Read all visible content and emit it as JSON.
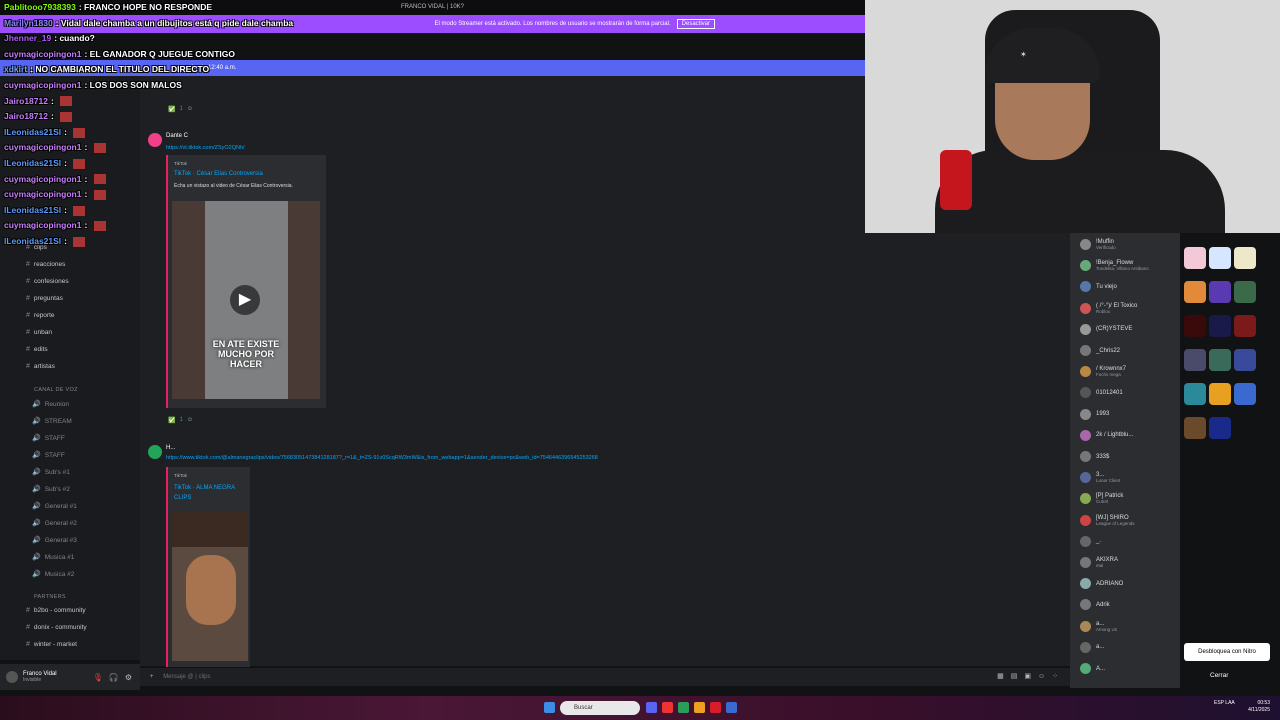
{
  "window_title": "FRANCO VIDAL | 10K?",
  "banner": {
    "message": "El modo Streamer está activado. Los nombres de usuario se mostrarán de forma parcial.",
    "button": "Desactivar"
  },
  "stage_bar": "desde 12:40 a.m.",
  "chat": [
    {
      "user": "Pablitooo7938393",
      "color": "#7fff00",
      "text": "FRANCO HOPE NO RESPONDE"
    },
    {
      "user": "Marilyn1830",
      "color": "#8a8aff",
      "text": "Vidal dale chamba a un dibujitos está q pide dale chamba"
    },
    {
      "user": "Jhenner_19",
      "color": "#b05cff",
      "text": "cuando?"
    },
    {
      "user": "cuymagicopingon1",
      "color": "#c87cff",
      "text": "EL GANADOR Q JUEGUE CONTIGO"
    },
    {
      "user": "xdkirt",
      "color": "#6fa8ff",
      "text": "NO CAMBIARON EL TITULO DEL DIRECTO"
    },
    {
      "user": "cuymagicopingon1",
      "color": "#c87cff",
      "text": "LOS DOS SON MALOS"
    },
    {
      "user": "Jairo18712",
      "color": "#c87cff",
      "text": ""
    },
    {
      "user": "Jairo18712",
      "color": "#c87cff",
      "text": ""
    },
    {
      "user": "lLeonidas21Sl",
      "color": "#5b9bff",
      "text": ""
    },
    {
      "user": "cuymagicopingon1",
      "color": "#c87cff",
      "text": ""
    },
    {
      "user": "lLeonidas21Sl",
      "color": "#5b9bff",
      "text": ""
    },
    {
      "user": "cuymagicopingon1",
      "color": "#c87cff",
      "text": ""
    },
    {
      "user": "cuymagicopingon1",
      "color": "#c87cff",
      "text": ""
    },
    {
      "user": "lLeonidas21Sl",
      "color": "#5b9bff",
      "text": ""
    },
    {
      "user": "cuymagicopingon1",
      "color": "#c87cff",
      "text": ""
    },
    {
      "user": "lLeonidas21Sl",
      "color": "#5b9bff",
      "text": ""
    }
  ],
  "sidebar": {
    "channels": [
      "clips",
      "reacciones",
      "confesiones",
      "preguntas",
      "reporte",
      "unban",
      "edits",
      "artistas"
    ],
    "voice_category": "CANAL DE VOZ",
    "voice": [
      "Reunion",
      "STREAM",
      "STAFF",
      "STAFF",
      "Sub's #1",
      "Sub's #2",
      "General #1",
      "General #2",
      "General #3",
      "Musica #1",
      "Musica #2"
    ],
    "partners_category": "PARTNERS",
    "partners": [
      "b2bo - community",
      "donix - community",
      "winter - market"
    ]
  },
  "user_panel": {
    "name": "Franco Vidal",
    "status": "Invisible"
  },
  "messages": [
    {
      "author": "Dante C",
      "link": "https://vt.tiktok.com/ZSyO2QNh/",
      "provider": "TikTok",
      "title": "TikTok · César Elias Controversia",
      "desc": "Echa un vistazo al video de César Elias Controversia.",
      "overlay": "EN ATE EXISTE MUCHO POR HACER",
      "reaction": "1"
    },
    {
      "author": "H...",
      "link": "https://www.tiktok.com/@almanegraclips/video/7568305147384128187?_r=1&_t=ZS-91v0ScqRW3mW&is_from_webapp=1&sender_device=pc&web_id=7546446396545253268",
      "provider": "TikTok",
      "title": "TikTok · ALMA NEGRA CLIPS",
      "reaction": "1"
    }
  ],
  "composer_placeholder": "Mensaje @ | clips",
  "members": [
    {
      "name": "!Muffin",
      "sub": "Verificado"
    },
    {
      "name": "!Benja_Floww",
      "sub": "Tondelita, Villano Antibano"
    },
    {
      "name": "Tu viejo",
      "sub": ""
    },
    {
      "name": "( /°-°)/ El Toxico",
      "sub": "Roblox"
    },
    {
      "name": "(CR)YSTEVE",
      "sub": ""
    },
    {
      "name": "_Chris22",
      "sub": ""
    },
    {
      "name": "/ Krownnx7",
      "sub": "Fuchs mega"
    },
    {
      "name": "01012401",
      "sub": ""
    },
    {
      "name": "1993",
      "sub": ""
    },
    {
      "name": "2k / Lightblu...",
      "sub": ""
    },
    {
      "name": "333$",
      "sub": ""
    },
    {
      "name": "3...",
      "sub": "Lunar Client"
    },
    {
      "name": "[P] Patrick",
      "sub": "Cutrel"
    },
    {
      "name": "[WJ] SHIRO",
      "sub": "League of Legends"
    },
    {
      "name": "_.",
      "sub": ""
    },
    {
      "name": "AKIXRA",
      "sub": "etal"
    },
    {
      "name": "ADRIANO",
      "sub": ""
    },
    {
      "name": "Adrik",
      "sub": ""
    },
    {
      "name": "a...",
      "sub": "Among Us"
    },
    {
      "name": "a...",
      "sub": ""
    },
    {
      "name": "A...",
      "sub": ""
    }
  ],
  "theme_colors": [
    "#f3c9d8",
    "#d6e6ff",
    "#efe7c9",
    "#e08a3a",
    "#5a3ab0",
    "#3a6a4a",
    "#3a0a0a",
    "#1a1a4a",
    "#7a1a1a",
    "#4a4a6a",
    "#3a6a5a",
    "#3a4a9a",
    "#2a8a9a",
    "#e8a020",
    "#3a6ad0",
    "#6a4a2a",
    "#1a2a8a"
  ],
  "nitro_button": "Desbloquea con Nitro",
  "close_button": "Cerrar",
  "taskbar": {
    "search": "Buscar",
    "lang": "ESP LAA",
    "time": "00:53",
    "date": "4/11/2025"
  }
}
